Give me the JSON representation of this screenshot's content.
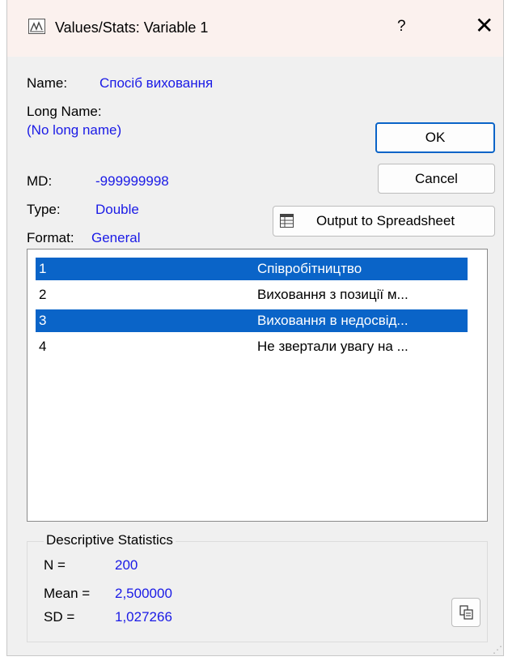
{
  "window": {
    "title": "Values/Stats: Variable 1",
    "help_label": "?",
    "close_label": "✕",
    "app_icon": "statistica-graph-icon"
  },
  "info": {
    "name_label": "Name:",
    "name_value": "Спосіб виховання",
    "long_name_label": "Long Name:",
    "long_name_value": "(No long name)",
    "md_label": "MD:",
    "md_value": "-999999998",
    "type_label": "Type:",
    "type_value": "Double",
    "format_label": "Format:",
    "format_value": "General"
  },
  "buttons": {
    "ok_label": "OK",
    "cancel_label": "Cancel",
    "output_label": "Output to Spreadsheet",
    "output_icon": "spreadsheet-icon",
    "copy_icon": "copy-icon"
  },
  "values_list": [
    {
      "code": "1",
      "label": "Співробітництво",
      "selected": true
    },
    {
      "code": "2",
      "label": "Виховання з позиції м...",
      "selected": false
    },
    {
      "code": "3",
      "label": "Виховання в недосвід...",
      "selected": true
    },
    {
      "code": "4",
      "label": "Не звертали увагу на ...",
      "selected": false
    }
  ],
  "stats": {
    "title": "Descriptive Statistics",
    "n_label": "N =",
    "n_value": "200",
    "mean_label": "Mean =",
    "mean_value": "2,500000",
    "sd_label": "SD =",
    "sd_value": "1,027266"
  },
  "colors": {
    "value_text": "#1a1ae6",
    "selection": "#0a64c8",
    "titlebar": "#fbf1ee"
  }
}
